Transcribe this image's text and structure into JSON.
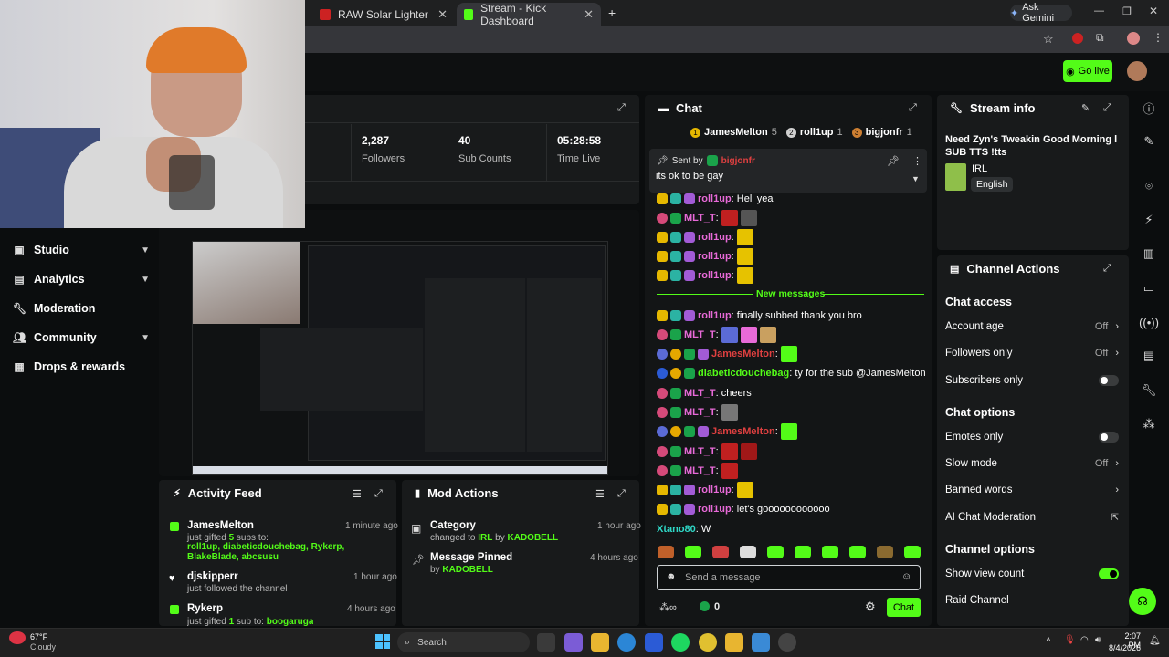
{
  "browser": {
    "tabs": [
      {
        "title": "RAW Solar Lighter"
      },
      {
        "title": "Stream - Kick Dashboard"
      }
    ],
    "ask_gemini": "Ask Gemini"
  },
  "header": {
    "go_live": "Go live"
  },
  "sidebar": {
    "items": [
      {
        "label": "Studio",
        "icon": "video-icon",
        "chevron": true
      },
      {
        "label": "Analytics",
        "icon": "chart-icon",
        "chevron": true
      },
      {
        "label": "Moderation",
        "icon": "wrench-icon",
        "chevron": false
      },
      {
        "label": "Community",
        "icon": "users-icon",
        "chevron": true
      },
      {
        "label": "Drops & rewards",
        "icon": "gift-icon",
        "chevron": false
      }
    ]
  },
  "stats": [
    {
      "value": "2,287",
      "label": "Followers"
    },
    {
      "value": "40",
      "label": "Sub Counts"
    },
    {
      "value": "05:28:58",
      "label": "Time Live"
    }
  ],
  "activity_feed": {
    "title": "Activity Feed",
    "items": [
      {
        "name": "JamesMelton",
        "time": "1 minute ago",
        "text_pre": "just gifted ",
        "count": "5",
        "text_post": " subs to:",
        "recipients": "roll1up, diabeticdouchebag, Rykerp, BlakeBlade, abcsusu"
      },
      {
        "name": "djskipperr",
        "time": "1 hour ago",
        "text": "just followed the channel"
      },
      {
        "name": "Rykerp",
        "time": "4 hours ago",
        "text_pre": "just gifted ",
        "count": "1",
        "text_post": " sub to: ",
        "recipients": "boogaruga"
      }
    ]
  },
  "mod_actions": {
    "title": "Mod Actions",
    "items": [
      {
        "title": "Category",
        "time": "1 hour ago",
        "line_pre": "changed to ",
        "line_hl": "IRL",
        "line_mid": " by ",
        "line_user": "KADOBELL"
      },
      {
        "title": "Message Pinned",
        "time": "4 hours ago",
        "line_pre": "by ",
        "line_user": "KADOBELL"
      }
    ]
  },
  "chat": {
    "title": "Chat",
    "top_gifters": [
      {
        "rank": "1",
        "name": "JamesMelton",
        "count": "5"
      },
      {
        "rank": "2",
        "name": "roll1up",
        "count": "1"
      },
      {
        "rank": "3",
        "name": "bigjonfr",
        "count": "1"
      }
    ],
    "pinned": {
      "sent_by": "Sent by",
      "user": "bigjonfr",
      "message": "its ok to be gay"
    },
    "new_messages": "New messages",
    "messages": [
      {
        "user": "roll1up",
        "color": "u-pink",
        "text": ": Hell yea",
        "badges": [
          "b-crown",
          "b-sub",
          "b-gift"
        ],
        "emotes": []
      },
      {
        "user": "MLT_T",
        "color": "u-pink",
        "text": ":",
        "badges": [
          "b-mod",
          "b-gr"
        ],
        "emotes": [
          "#c02020",
          "#555"
        ]
      },
      {
        "user": "roll1up",
        "color": "u-pink",
        "text": ":",
        "badges": [
          "b-crown",
          "b-sub",
          "b-gift"
        ],
        "emotes": [
          "#e6c200"
        ]
      },
      {
        "user": "roll1up",
        "color": "u-pink",
        "text": ":",
        "badges": [
          "b-crown",
          "b-sub",
          "b-gift"
        ],
        "emotes": [
          "#e6c200"
        ]
      },
      {
        "user": "roll1up",
        "color": "u-pink",
        "text": ":",
        "badges": [
          "b-crown",
          "b-sub",
          "b-gift"
        ],
        "emotes": [
          "#e6c200"
        ]
      },
      {
        "user": "roll1up",
        "color": "u-pink",
        "text": ": finally subbed thank you bro",
        "badges": [
          "b-crown",
          "b-sub",
          "b-gift"
        ],
        "emotes": []
      },
      {
        "user": "MLT_T",
        "color": "u-pink",
        "text": ":",
        "badges": [
          "b-mod",
          "b-gr"
        ],
        "emotes": [
          "#5b6bd6",
          "#e86ad8",
          "#c9a060"
        ]
      },
      {
        "user": "JamesMelton",
        "color": "u-red",
        "text": ":",
        "badges": [
          "b-vip",
          "b-yel",
          "b-gr",
          "b-gift"
        ],
        "emotes": [
          "#53fc18"
        ]
      },
      {
        "user": "diabeticdouchebag",
        "color": "u-green",
        "text": ": ty for the sub @JamesMelton",
        "badges": [
          "b-blue",
          "b-yel",
          "b-gr"
        ],
        "emotes": []
      },
      {
        "user": "MLT_T",
        "color": "u-pink",
        "text": ": cheers",
        "badges": [
          "b-mod",
          "b-gr"
        ],
        "emotes": []
      },
      {
        "user": "MLT_T",
        "color": "u-pink",
        "text": ":",
        "badges": [
          "b-mod",
          "b-gr"
        ],
        "emotes": [
          "#777"
        ]
      },
      {
        "user": "JamesMelton",
        "color": "u-red",
        "text": ":",
        "badges": [
          "b-vip",
          "b-yel",
          "b-gr",
          "b-gift"
        ],
        "emotes": [
          "#53fc18"
        ]
      },
      {
        "user": "MLT_T",
        "color": "u-pink",
        "text": ":",
        "badges": [
          "b-mod",
          "b-gr"
        ],
        "emotes": [
          "#c02020",
          "#a01818"
        ]
      },
      {
        "user": "MLT_T",
        "color": "u-pink",
        "text": ":",
        "badges": [
          "b-mod",
          "b-gr"
        ],
        "emotes": [
          "#c02020"
        ]
      },
      {
        "user": "roll1up",
        "color": "u-pink",
        "text": ":",
        "badges": [
          "b-crown",
          "b-sub",
          "b-gift"
        ],
        "emotes": [
          "#e6c200"
        ]
      },
      {
        "user": "roll1up",
        "color": "u-pink",
        "text": ": let's goooooooooooo",
        "badges": [
          "b-crown",
          "b-sub",
          "b-gift"
        ],
        "emotes": []
      },
      {
        "user": "Xtano80",
        "color": "u-cyan",
        "text": ": W",
        "badges": [],
        "emotes": []
      }
    ],
    "emote_bar": [
      "#c0602a",
      "#53fc18",
      "#d04040",
      "#ddd",
      "#53fc18",
      "#53fc18",
      "#53fc18",
      "#53fc18",
      "#8a6a30",
      "#53fc18"
    ],
    "input_placeholder": "Send a message",
    "kicks_count": "0",
    "send_label": "Chat"
  },
  "stream_info": {
    "title": "Stream info",
    "stream_title": "Need Zyn's Tweakin Good Morning l SUB TTS !tts",
    "category": "IRL",
    "language": "English"
  },
  "channel_actions": {
    "title": "Channel Actions",
    "chat_access": "Chat access",
    "account_age": {
      "label": "Account age",
      "value": "Off"
    },
    "followers_only": {
      "label": "Followers only",
      "value": "Off"
    },
    "subscribers_only": {
      "label": "Subscribers only",
      "on": false
    },
    "chat_options": "Chat options",
    "emotes_only": {
      "label": "Emotes only",
      "on": false
    },
    "slow_mode": {
      "label": "Slow mode",
      "value": "Off"
    },
    "banned_words": "Banned words",
    "ai_moderation": "AI Chat Moderation",
    "channel_options": "Channel options",
    "show_view_count": {
      "label": "Show view count",
      "on": true
    },
    "raid_channel": "Raid Channel"
  },
  "taskbar": {
    "weather_temp": "67°F",
    "weather_desc": "Cloudy",
    "search": "Search",
    "time": "2:07 PM",
    "date": "8/4/2026"
  }
}
